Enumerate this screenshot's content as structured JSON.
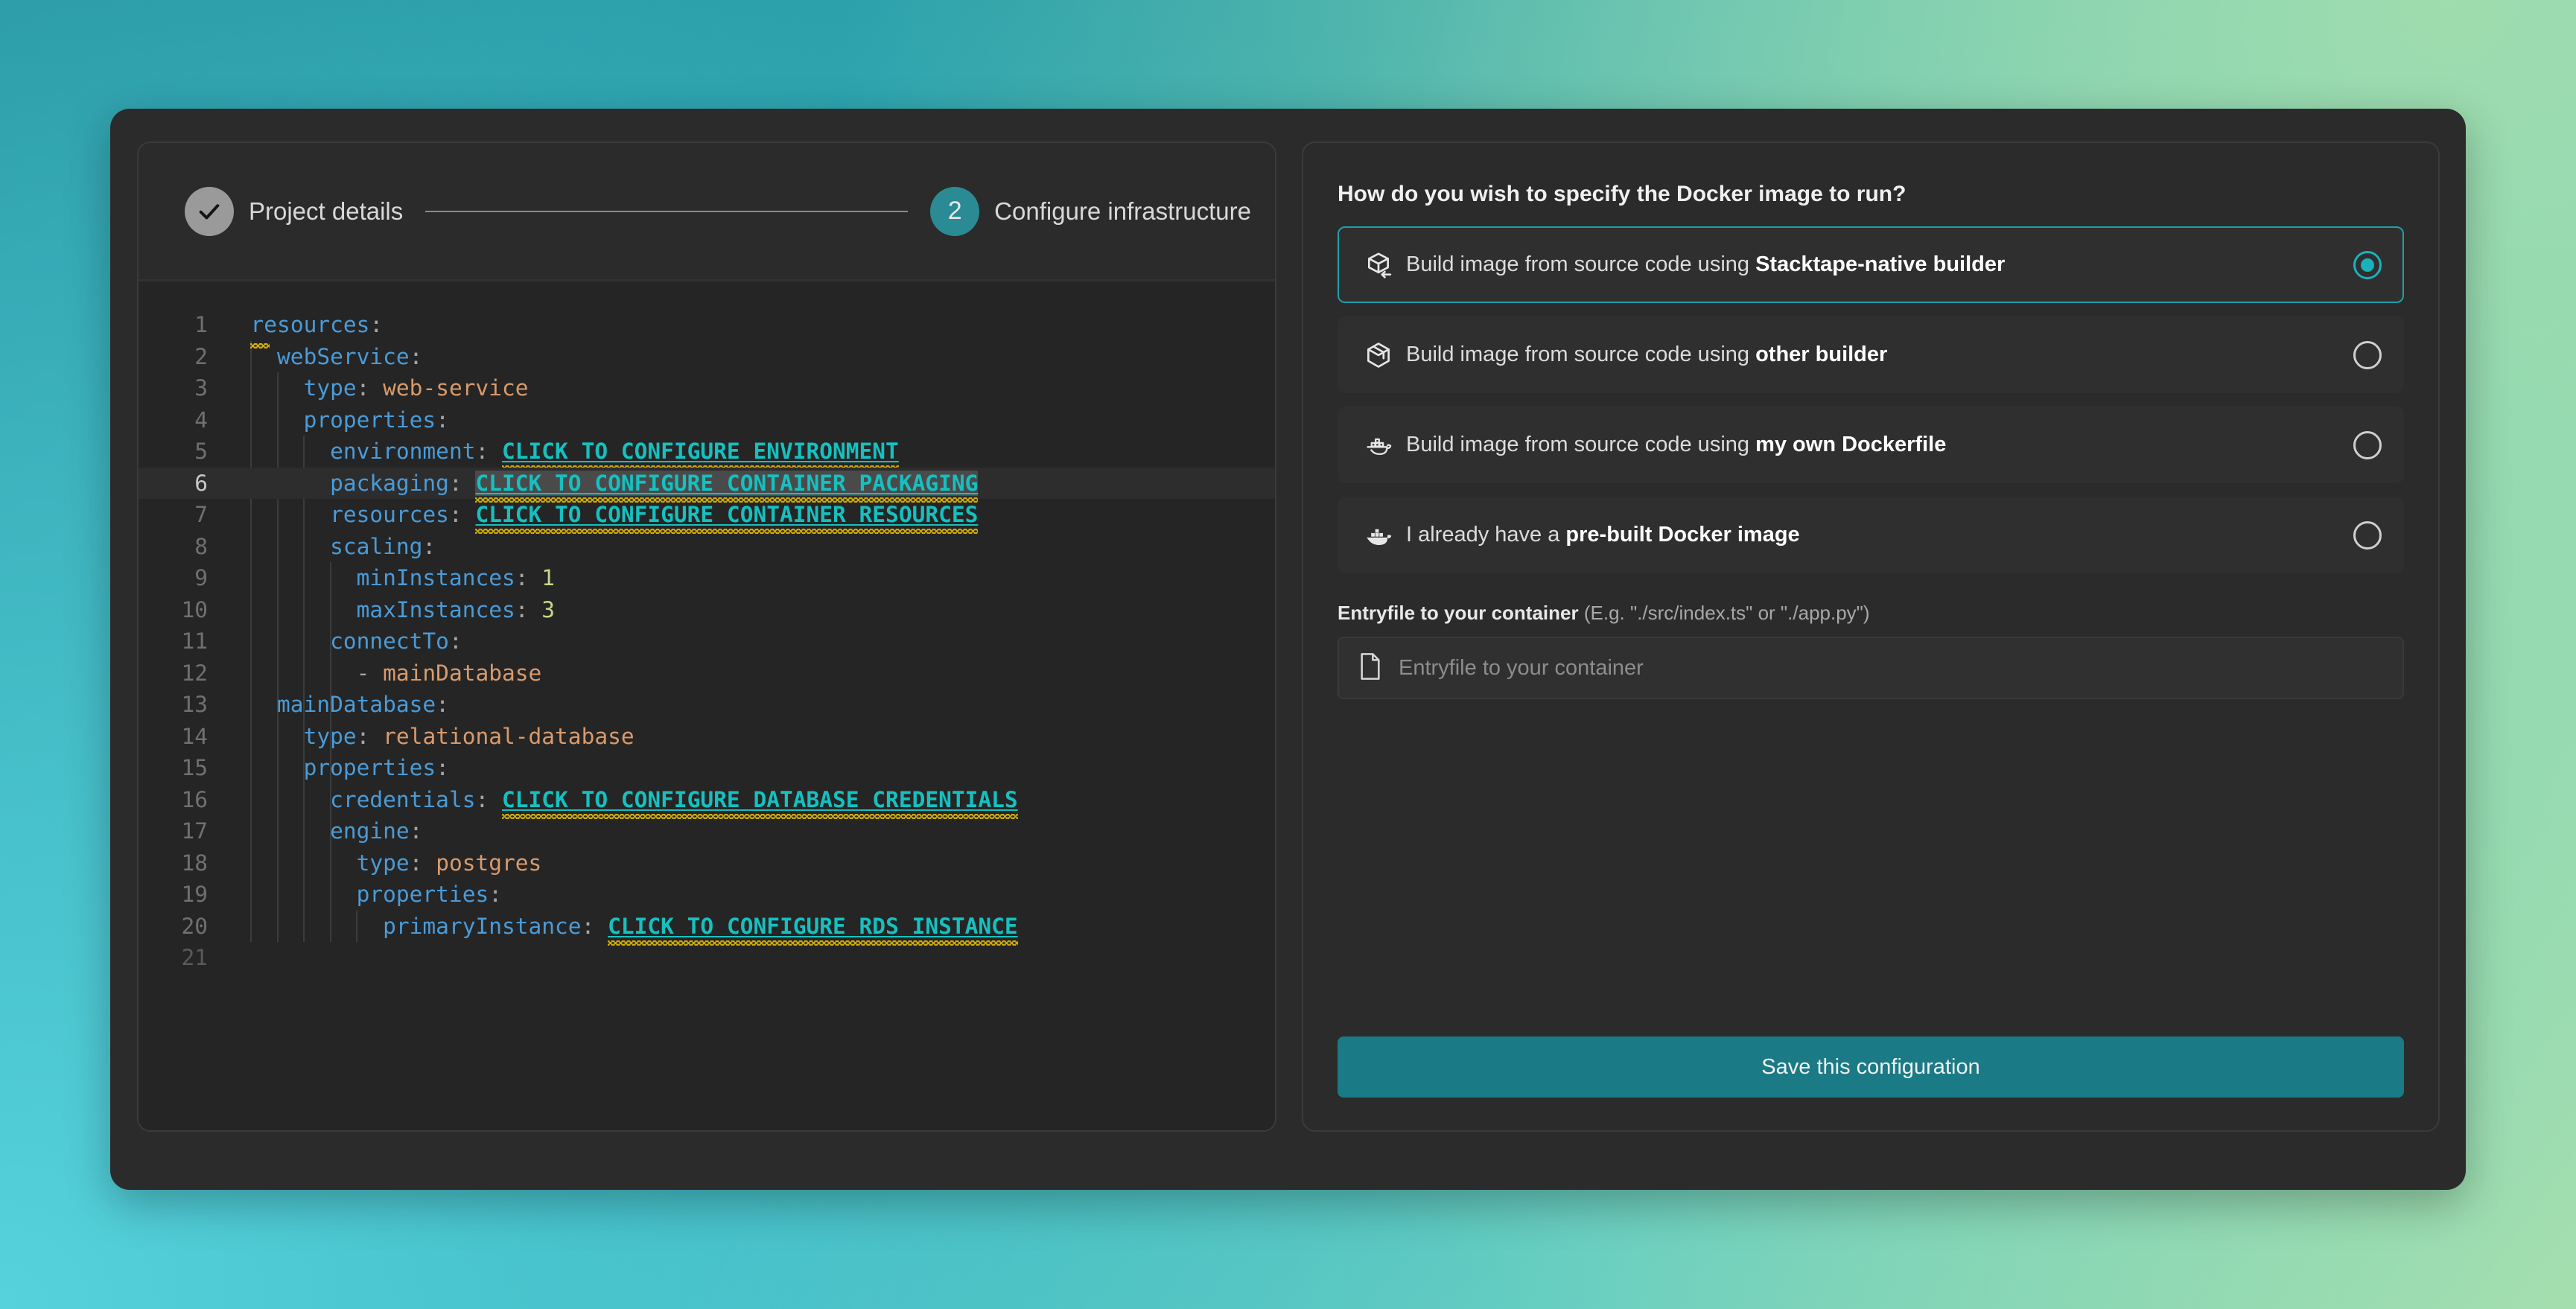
{
  "theme": {
    "accent": "#1fa0a8",
    "accent_dark": "#1a7a85",
    "step_active_bg": "#2b8b94",
    "step_done_bg": "#9a9a9a",
    "click_token": "#16c0c0",
    "squiggle": "#d4b106",
    "panel_bg": "#2b2b2b",
    "editor_bg": "#252525",
    "bg_gradient_from": "#1e8a97",
    "bg_gradient_to": "#a6dfae"
  },
  "stepper": {
    "steps": [
      {
        "number": "1",
        "label": "Project details",
        "state": "done",
        "icon": "check-icon"
      },
      {
        "number": "2",
        "label": "Configure infrastructure",
        "state": "active"
      }
    ]
  },
  "editor": {
    "total_lines": 21,
    "active_line": 6,
    "lines": [
      {
        "n": "1",
        "indent": 0,
        "tokens": [
          {
            "t": "key",
            "v": "resources"
          },
          {
            "t": "punct",
            "v": ":"
          }
        ],
        "warn_small": true
      },
      {
        "n": "2",
        "indent": 1,
        "tokens": [
          {
            "t": "key",
            "v": "webService"
          },
          {
            "t": "punct",
            "v": ":"
          }
        ]
      },
      {
        "n": "3",
        "indent": 2,
        "tokens": [
          {
            "t": "key",
            "v": "type"
          },
          {
            "t": "punct",
            "v": ": "
          },
          {
            "t": "str",
            "v": "web-service"
          }
        ]
      },
      {
        "n": "4",
        "indent": 2,
        "tokens": [
          {
            "t": "key",
            "v": "properties"
          },
          {
            "t": "punct",
            "v": ":"
          }
        ]
      },
      {
        "n": "5",
        "indent": 3,
        "tokens": [
          {
            "t": "key",
            "v": "environment"
          },
          {
            "t": "punct",
            "v": ": "
          },
          {
            "t": "click",
            "v": "CLICK TO CONFIGURE ENVIRONMENT"
          }
        ]
      },
      {
        "n": "6",
        "indent": 3,
        "tokens": [
          {
            "t": "key",
            "v": "packaging"
          },
          {
            "t": "punct",
            "v": ": "
          },
          {
            "t": "click",
            "v": "CLICK TO CONFIGURE CONTAINER PACKAGING",
            "hl": true
          }
        ]
      },
      {
        "n": "7",
        "indent": 3,
        "tokens": [
          {
            "t": "key",
            "v": "resources"
          },
          {
            "t": "punct",
            "v": ": "
          },
          {
            "t": "click",
            "v": "CLICK TO CONFIGURE CONTAINER RESOURCES"
          }
        ]
      },
      {
        "n": "8",
        "indent": 3,
        "tokens": [
          {
            "t": "key",
            "v": "scaling"
          },
          {
            "t": "punct",
            "v": ":"
          }
        ]
      },
      {
        "n": "9",
        "indent": 4,
        "tokens": [
          {
            "t": "key",
            "v": "minInstances"
          },
          {
            "t": "punct",
            "v": ": "
          },
          {
            "t": "num",
            "v": "1"
          }
        ]
      },
      {
        "n": "10",
        "indent": 4,
        "tokens": [
          {
            "t": "key",
            "v": "maxInstances"
          },
          {
            "t": "punct",
            "v": ": "
          },
          {
            "t": "num",
            "v": "3"
          }
        ]
      },
      {
        "n": "11",
        "indent": 3,
        "tokens": [
          {
            "t": "key",
            "v": "connectTo"
          },
          {
            "t": "punct",
            "v": ":"
          }
        ]
      },
      {
        "n": "12",
        "indent": 4,
        "tokens": [
          {
            "t": "dash",
            "v": "- "
          },
          {
            "t": "str",
            "v": "mainDatabase"
          }
        ]
      },
      {
        "n": "13",
        "indent": 1,
        "tokens": [
          {
            "t": "key",
            "v": "mainDatabase"
          },
          {
            "t": "punct",
            "v": ":"
          }
        ]
      },
      {
        "n": "14",
        "indent": 2,
        "tokens": [
          {
            "t": "key",
            "v": "type"
          },
          {
            "t": "punct",
            "v": ": "
          },
          {
            "t": "str",
            "v": "relational-database"
          }
        ]
      },
      {
        "n": "15",
        "indent": 2,
        "tokens": [
          {
            "t": "key",
            "v": "properties"
          },
          {
            "t": "punct",
            "v": ":"
          }
        ]
      },
      {
        "n": "16",
        "indent": 3,
        "tokens": [
          {
            "t": "key",
            "v": "credentials"
          },
          {
            "t": "punct",
            "v": ": "
          },
          {
            "t": "click",
            "v": "CLICK TO CONFIGURE DATABASE CREDENTIALS"
          }
        ]
      },
      {
        "n": "17",
        "indent": 3,
        "tokens": [
          {
            "t": "key",
            "v": "engine"
          },
          {
            "t": "punct",
            "v": ":"
          }
        ]
      },
      {
        "n": "18",
        "indent": 4,
        "tokens": [
          {
            "t": "key",
            "v": "type"
          },
          {
            "t": "punct",
            "v": ": "
          },
          {
            "t": "str",
            "v": "postgres"
          }
        ]
      },
      {
        "n": "19",
        "indent": 4,
        "tokens": [
          {
            "t": "key",
            "v": "properties"
          },
          {
            "t": "punct",
            "v": ":"
          }
        ]
      },
      {
        "n": "20",
        "indent": 5,
        "tokens": [
          {
            "t": "key",
            "v": "primaryInstance"
          },
          {
            "t": "punct",
            "v": ": "
          },
          {
            "t": "click",
            "v": "CLICK TO CONFIGURE RDS INSTANCE"
          }
        ]
      },
      {
        "n": "21",
        "indent": 0,
        "tokens": [],
        "dim": true
      }
    ]
  },
  "right_panel": {
    "question": "How do you wish to specify the Docker image to run?",
    "options": [
      {
        "icon": "cube-arrow-icon",
        "text_before": "Build image from source code using ",
        "text_bold": "Stacktape-native builder",
        "text_after": "",
        "selected": true
      },
      {
        "icon": "package-box-icon",
        "text_before": "Build image from source code using ",
        "text_bold": "other builder",
        "text_after": "",
        "selected": false
      },
      {
        "icon": "docker-whale-outline-icon",
        "text_before": "Build image from source code using ",
        "text_bold": "my own Dockerfile",
        "text_after": "",
        "selected": false
      },
      {
        "icon": "docker-whale-icon",
        "text_before": "I already have a ",
        "text_bold": "pre-built Docker image",
        "text_after": "",
        "selected": false
      }
    ],
    "entryfile": {
      "label": "Entryfile to your container",
      "hint": "(E.g. \"./src/index.ts\" or \"./app.py\")",
      "placeholder": "Entryfile to your container",
      "value": "",
      "icon": "file-icon"
    },
    "save_button": "Save this configuration"
  }
}
